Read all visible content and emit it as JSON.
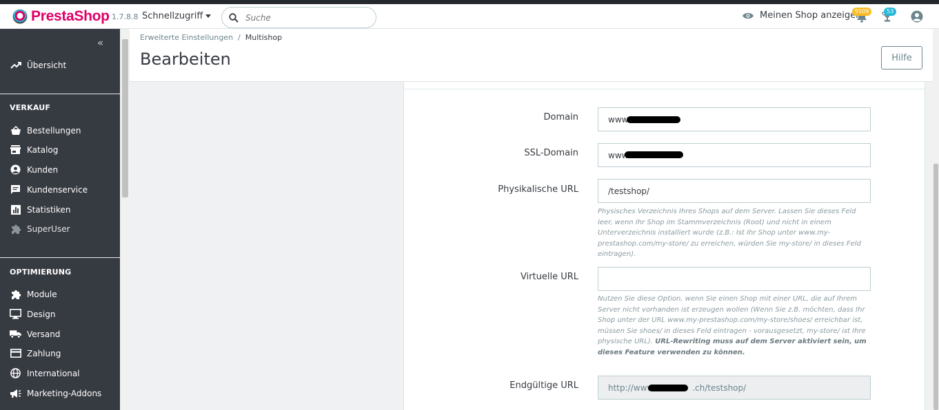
{
  "header": {
    "logo_text": "PrestaShop",
    "version": "1.7.8.8",
    "quick_access": "Schnellzugriff",
    "search_placeholder": "Suche",
    "view_shop": "Meinen Shop anzeigen",
    "notifications": [
      {
        "icon": "bell-icon",
        "count": "9109",
        "color": "#fbbb22"
      },
      {
        "icon": "trophy-icon",
        "count": "53",
        "color": "#25b9d7"
      }
    ],
    "user_icon": "account-circle-icon"
  },
  "sidebar": {
    "overview": "Übersicht",
    "sections": [
      {
        "title": "VERKAUF",
        "items": [
          {
            "label": "Bestellungen",
            "icon": "basket-icon"
          },
          {
            "label": "Katalog",
            "icon": "store-icon"
          },
          {
            "label": "Kunden",
            "icon": "account-circle-icon"
          },
          {
            "label": "Kundenservice",
            "icon": "chat-icon"
          },
          {
            "label": "Statistiken",
            "icon": "bar-chart-icon"
          },
          {
            "label": "SuperUser",
            "icon": "puzzle-icon"
          }
        ]
      },
      {
        "title": "OPTIMIERUNG",
        "items": [
          {
            "label": "Module",
            "icon": "puzzle-icon"
          },
          {
            "label": "Design",
            "icon": "monitor-icon"
          },
          {
            "label": "Versand",
            "icon": "truck-icon"
          },
          {
            "label": "Zahlung",
            "icon": "credit-card-icon"
          },
          {
            "label": "International",
            "icon": "globe-icon"
          },
          {
            "label": "Marketing-Addons",
            "icon": "megaphone-icon"
          }
        ]
      }
    ]
  },
  "toolbar": {
    "breadcrumb": [
      "Erweiterte Einstellungen",
      "Multishop"
    ],
    "title": "Bearbeiten",
    "help": "Hilfe"
  },
  "form": {
    "domain": {
      "label": "Domain",
      "value": "www."
    },
    "ssl_domain": {
      "label": "SSL-Domain",
      "value": "www"
    },
    "physical_url": {
      "label": "Physikalische URL",
      "value": "/testshop/",
      "hint": "Physisches Verzeichnis Ihres Shops auf dem Server. Lassen Sie dieses Feld leer, wenn Ihr Shop im Stammverzeichnis (Root) und nicht in einem Unterverzeichnis installiert wurde (z.B.: Ist Ihr Shop unter www.my-prestashop.com/my-store/ zu erreichen, würden Sie my-store/ in dieses Feld eintragen)."
    },
    "virtual_url": {
      "label": "Virtuelle URL",
      "value": "",
      "hint": "Nutzen Sie diese Option, wenn Sie einen Shop mit einer URL, die auf Ihrem Server nicht vorhanden ist erzeugen wollen (Wenn Sie z.B. möchten, dass Ihr Shop unter der URL www.my-prestashop.com/my-store/shoes/ erreichbar ist, müssen Sie shoes/ in dieses Feld eintragen - vorausgesetzt, my-store/ ist Ihre physische URL).",
      "hint_bold": "URL-Rewriting muss auf dem Server aktiviert sein, um dieses Feature verwenden zu können."
    },
    "final_url": {
      "label": "Endgültige URL",
      "value_prefix": "http://www",
      "value_suffix": ".ch/testshop/"
    }
  }
}
